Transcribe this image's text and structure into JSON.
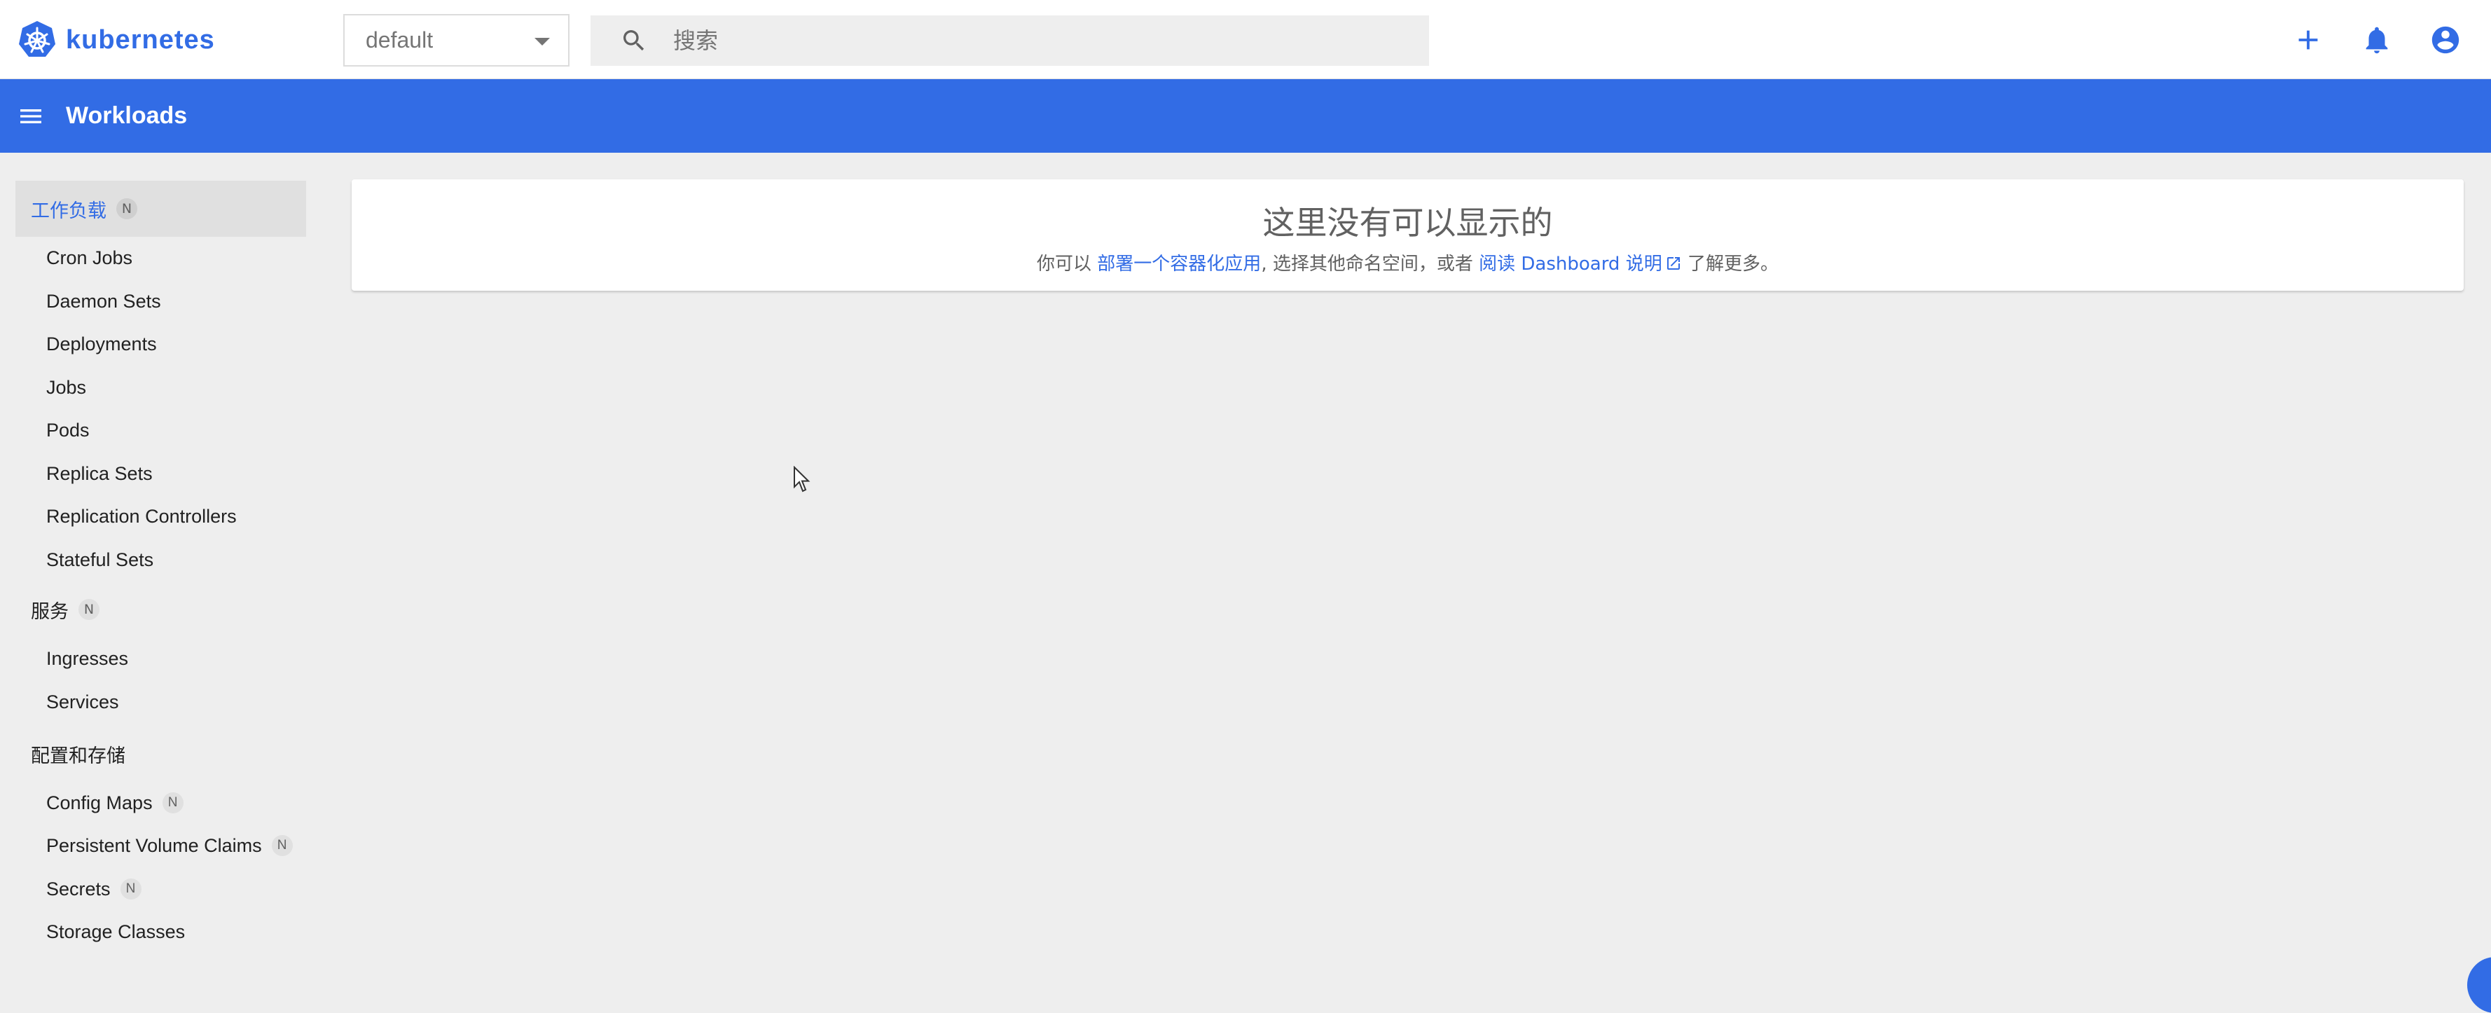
{
  "brand": {
    "name": "kubernetes",
    "color": "#326ce5"
  },
  "namespace": {
    "selected": "default"
  },
  "search": {
    "placeholder": "搜索"
  },
  "top_actions": [
    {
      "name": "add-icon"
    },
    {
      "name": "bell-icon"
    },
    {
      "name": "account-icon"
    }
  ],
  "appbar": {
    "title": "Workloads"
  },
  "sidebar": {
    "sections": [
      {
        "label": "工作负载",
        "badge": "N",
        "active": true,
        "items": [
          "Cron Jobs",
          "Daemon Sets",
          "Deployments",
          "Jobs",
          "Pods",
          "Replica Sets",
          "Replication Controllers",
          "Stateful Sets"
        ]
      },
      {
        "label": "服务",
        "badge": "N",
        "active": false,
        "items": [
          "Ingresses",
          "Services"
        ]
      },
      {
        "label": "配置和存储",
        "badge": "",
        "active": false,
        "items": [
          {
            "label": "Config Maps",
            "badge": "N"
          },
          {
            "label": "Persistent Volume Claims",
            "badge": "N"
          },
          {
            "label": "Secrets",
            "badge": "N"
          },
          {
            "label": "Storage Classes",
            "badge": ""
          }
        ]
      }
    ]
  },
  "empty_state": {
    "title": "这里没有可以显示的",
    "sub_prefix": "你可以 ",
    "deploy_link": "部署一个容器化应用",
    "sub_middle": ", 选择其他命名空间，或者 ",
    "docs_link": "阅读 Dashboard 说明",
    "sub_suffix": " 了解更多。"
  },
  "colors": {
    "accent": "#326ce5",
    "background": "#eeeeee",
    "active_bg": "#e0e0e0"
  }
}
